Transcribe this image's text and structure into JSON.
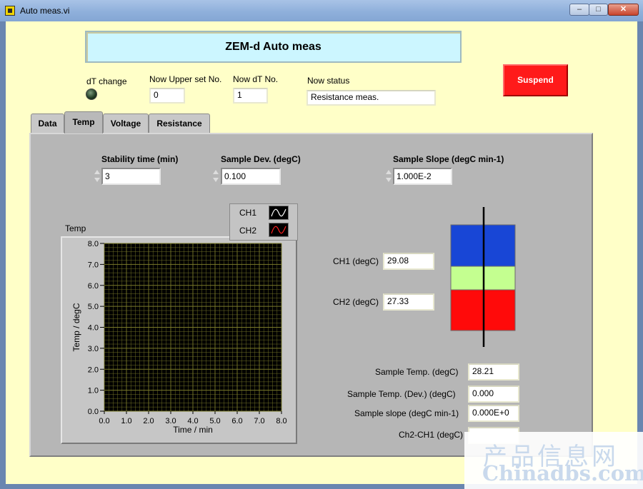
{
  "window": {
    "title": "Auto meas.vi",
    "min_glyph": "–",
    "max_glyph": "□",
    "close_glyph": "✕"
  },
  "header": {
    "title": "ZEM-d Auto meas"
  },
  "status": {
    "dt_change_label": "dT change",
    "upper_set_label": "Now Upper set No.",
    "upper_set_value": "0",
    "dt_no_label": "Now dT No.",
    "dt_no_value": "1",
    "now_status_label": "Now status",
    "now_status_value": "Resistance meas."
  },
  "suspend_button": {
    "label": "Suspend"
  },
  "tabs": [
    {
      "label": "Data",
      "active": false
    },
    {
      "label": "Temp",
      "active": true
    },
    {
      "label": "Voltage",
      "active": false
    },
    {
      "label": "Resistance",
      "active": false
    }
  ],
  "controls": {
    "stability_time_label": "Stability time (min)",
    "stability_time_value": "3",
    "sample_dev_label": "Sample Dev. (degC)",
    "sample_dev_value": "0.100",
    "sample_slope_label": "Sample Slope (degC min-1)",
    "sample_slope_value": "1.000E-2"
  },
  "graph": {
    "title": "Temp"
  },
  "chart_data": {
    "type": "line",
    "title": "Temp",
    "xlabel": "Time / min",
    "ylabel": "Temp / degC",
    "xlim": [
      0,
      8
    ],
    "ylim": [
      0,
      8
    ],
    "x_ticks": [
      "0.0",
      "1.0",
      "2.0",
      "3.0",
      "4.0",
      "5.0",
      "6.0",
      "7.0",
      "8.0"
    ],
    "y_ticks": [
      "0.0",
      "1.0",
      "2.0",
      "3.0",
      "4.0",
      "5.0",
      "6.0",
      "7.0",
      "8.0"
    ],
    "grid": true,
    "legend_position": "top-right",
    "series": [
      {
        "name": "CH1",
        "color": "#ffffff",
        "values": []
      },
      {
        "name": "CH2",
        "color": "#ff2020",
        "values": []
      }
    ],
    "plot_background": "#000000",
    "grid_color": "#7a7a2a"
  },
  "readings": {
    "ch1_label": "CH1 (degC)",
    "ch1_value": "29.08",
    "ch2_label": "CH2 (degC)",
    "ch2_value": "27.33",
    "sample_temp_label": "Sample Temp. (degC)",
    "sample_temp_value": "28.21",
    "sample_temp_dev_label": "Sample Temp. (Dev.) (degC)",
    "sample_temp_dev_value": "0.000",
    "sample_slope_label": "Sample slope (degC min-1)",
    "sample_slope_value": "0.000E+0",
    "ch2_ch1_label": "Ch2-CH1 (degC)",
    "ch2_ch1_value": ""
  },
  "colors": {
    "gauge_top": "#1846d6",
    "gauge_mid": "#c4ff90",
    "gauge_bottom": "#ff0a0a",
    "suspend": "#ff1a1a",
    "window_bg": "#ffffc8",
    "banner_bg": "#ccf6ff"
  },
  "watermark": {
    "cn": "产品信息网",
    "en": "Chinadbs.com"
  }
}
